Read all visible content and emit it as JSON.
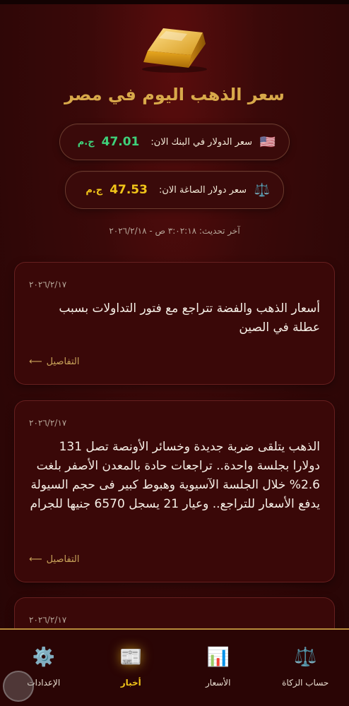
{
  "header": {
    "title": "سعر الذهب اليوم في مصر"
  },
  "rates": {
    "bank": {
      "icon": "🇺🇸",
      "label": "سعر الدولار في البنك الان:",
      "value": "47.01",
      "unit": "ج.م"
    },
    "gold": {
      "icon": "⚖️",
      "label": "سعر دولار الصاغة الان:",
      "value": "47.53",
      "unit": "ج.م"
    }
  },
  "last_update": "آخر تحديث: ٣:٠٢:١٨ ص - ٢٠٢٦/٢/١٨",
  "news": [
    {
      "date": "٢٠٢٦/٢/١٧",
      "body": "أسعار الذهب والفضة تتراجع مع فتور التداولات بسبب عطلة في الصين",
      "details": "التفاصيل"
    },
    {
      "date": "٢٠٢٦/٢/١٧",
      "body": "الذهب يتلقى ضربة جديدة وخسائر الأونصة تصل 131 دولارا بجلسة واحدة.. تراجعات حادة بالمعدن الأصفر بلغت 2.6% خلال الجلسة الآسيوية وهبوط كبير فى حجم السيولة يدفع الأسعار للتراجع.. وعيار 21 يسجل 6570 جنيها للجرام",
      "details": "التفاصيل"
    },
    {
      "date": "٢٠٢٦/٢/١٧"
    }
  ],
  "nav": {
    "zakat": "حساب الزكاة",
    "prices": "الأسعار",
    "news": "أخبار",
    "settings": "الإعدادات"
  },
  "icons": {
    "zakat": "scale-icon",
    "prices": "bar-chart-icon",
    "news": "newspaper-icon",
    "settings": "gear-icon",
    "details": "arrow-left-icon"
  },
  "colors": {
    "background": "#2a0606",
    "title_gold": "#d8a94a",
    "bank_green": "#3fd17a",
    "gold_yellow": "#f0c419",
    "nav_border": "#b78a3a"
  }
}
